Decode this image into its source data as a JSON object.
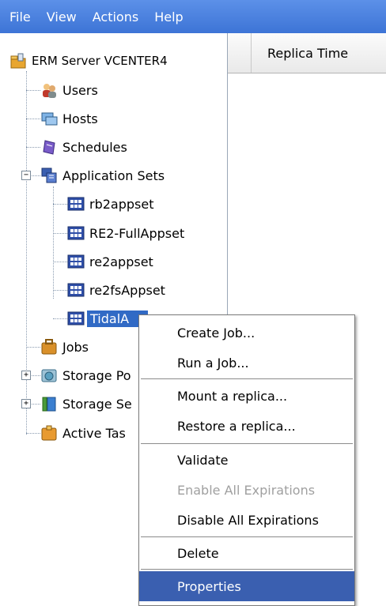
{
  "menubar": {
    "items": [
      {
        "label": "File"
      },
      {
        "label": "View"
      },
      {
        "label": "Actions"
      },
      {
        "label": "Help"
      }
    ]
  },
  "tree": {
    "root": "ERM Server VCENTER4",
    "users": "Users",
    "hosts": "Hosts",
    "schedules": "Schedules",
    "app_sets": "Application Sets",
    "app_set_items": [
      "rb2appset",
      "RE2-FullAppset",
      "re2appset",
      "re2fsAppset",
      "TidalA"
    ],
    "jobs": "Jobs",
    "storage_pools": "Storage Po",
    "storage_sets": "Storage Se",
    "active_tasks": "Active Tas",
    "expander_minus": "−",
    "expander_plus": "+"
  },
  "table": {
    "columns": [
      "Replica Time"
    ]
  },
  "context_menu": {
    "items": [
      {
        "label": "Create Job...",
        "enabled": true
      },
      {
        "label": "Run a Job...",
        "enabled": true
      },
      {
        "label": "Mount a replica...",
        "enabled": true
      },
      {
        "label": "Restore a replica...",
        "enabled": true
      },
      {
        "label": "Validate",
        "enabled": true
      },
      {
        "label": "Enable All Expirations",
        "enabled": false
      },
      {
        "label": "Disable All Expirations",
        "enabled": true
      },
      {
        "label": "Delete",
        "enabled": true
      },
      {
        "label": "Properties",
        "enabled": true,
        "highlighted": true
      }
    ]
  },
  "colors": {
    "menubar": "#3d74d6",
    "selection": "#316ac5",
    "menu_highlight": "#3a5fb0"
  }
}
